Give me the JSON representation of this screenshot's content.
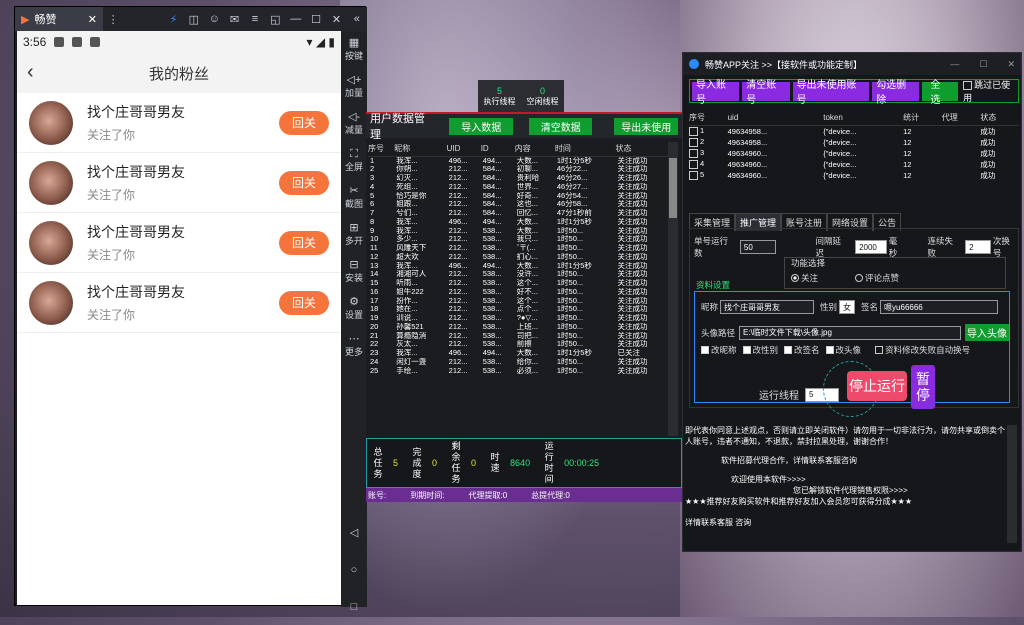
{
  "emulator": {
    "tab_title": "畅赞",
    "side": [
      "按键",
      "加量",
      "减量",
      "全屏",
      "截图",
      "多开",
      "安装",
      "设置",
      "更多"
    ]
  },
  "phone": {
    "time": "3:56",
    "page_title": "我的粉丝",
    "fans": [
      {
        "name": "找个庄哥哥男友",
        "sub": "关注了你",
        "btn": "回关"
      },
      {
        "name": "找个庄哥哥男友",
        "sub": "关注了你",
        "btn": "回关"
      },
      {
        "name": "找个庄哥哥男友",
        "sub": "关注了你",
        "btn": "回关"
      },
      {
        "name": "找个庄哥哥男友",
        "sub": "关注了你",
        "btn": "回关"
      }
    ]
  },
  "threads": {
    "exec_value": "5",
    "exec_label": "执行线程",
    "idle_value": "0",
    "idle_label": "空闲线程"
  },
  "userdata": {
    "title": "用户数据管理",
    "import": "导入数据",
    "clear": "清空数据",
    "export": "导出未使用",
    "columns": [
      "序号",
      "昵称",
      "UID",
      "ID",
      "内容",
      "时间",
      "状态"
    ],
    "rows": [
      [
        "1",
        "我浑...",
        "496...",
        "494...",
        "大数...",
        "1时1分5秒",
        "关注成功"
      ],
      [
        "2",
        "你朔...",
        "212...",
        "584...",
        "初聊...",
        "46分22...",
        "关注成功"
      ],
      [
        "3",
        "幻灭...",
        "212...",
        "584...",
        "贵利哈",
        "46分26...",
        "关注成功"
      ],
      [
        "4",
        "死组...",
        "212...",
        "584...",
        "世界...",
        "46分27...",
        "关注成功"
      ],
      [
        "5",
        "恰巧是你",
        "212...",
        "584...",
        "好奇...",
        "46分54...",
        "关注成功"
      ],
      [
        "6",
        "姐跟...",
        "212...",
        "584...",
        "这也...",
        "46分58...",
        "关注成功"
      ],
      [
        "7",
        "兮们...",
        "212...",
        "584...",
        "回忆...",
        "47分1秒前",
        "关注成功"
      ],
      [
        "8",
        "我浑...",
        "496...",
        "494...",
        "大数...",
        "1时1分5秒",
        "关注成功"
      ],
      [
        "9",
        "我浑...",
        "212...",
        "538...",
        "大数...",
        "1时50...",
        "关注成功"
      ],
      [
        "10",
        "多少...",
        "212...",
        "538...",
        "我只...",
        "1时50...",
        "关注成功"
      ],
      [
        "11",
        "风雕天下",
        "212...",
        "538...",
        "ˇ〒(...",
        "1时50...",
        "关注成功"
      ],
      [
        "12",
        "超大欢",
        "212...",
        "538...",
        "扪心...",
        "1时50...",
        "关注成功"
      ],
      [
        "13",
        "我浑...",
        "496...",
        "494...",
        "大数...",
        "1时1分5秒",
        "关注成功"
      ],
      [
        "14",
        "湘湘可人",
        "212...",
        "538...",
        "没许...",
        "1时50...",
        "关注成功"
      ],
      [
        "15",
        "听雨...",
        "212...",
        "538...",
        "这个...",
        "1时50...",
        "关注成功"
      ],
      [
        "16",
        "姐牛222",
        "212...",
        "538...",
        "好不...",
        "1时50...",
        "关注成功"
      ],
      [
        "17",
        "扮作...",
        "212...",
        "538...",
        "这个...",
        "1时50...",
        "关注成功"
      ],
      [
        "18",
        "她在...",
        "212...",
        "538...",
        "点个...",
        "1时50...",
        "关注成功"
      ],
      [
        "19",
        "训说...",
        "212...",
        "538...",
        "?●▽...",
        "1时50...",
        "关注成功"
      ],
      [
        "20",
        "孙馨521",
        "212...",
        "538...",
        "上班...",
        "1时50...",
        "关注成功"
      ],
      [
        "21",
        "算瘾隐消",
        "212...",
        "538...",
        "司把...",
        "1时50...",
        "关注成功"
      ],
      [
        "22",
        "灰太...",
        "212...",
        "538...",
        "前擦",
        "1时50...",
        "关注成功"
      ],
      [
        "23",
        "我浑...",
        "496...",
        "494...",
        "大数...",
        "1时1分5秒",
        "已关注"
      ],
      [
        "24",
        "闲灯一盏",
        "212...",
        "538...",
        "给你...",
        "1时50...",
        "关注成功"
      ],
      [
        "25",
        "手绘...",
        "212...",
        "538...",
        "必须...",
        "1时50...",
        "关注成功"
      ]
    ]
  },
  "stats": {
    "total_label": "总任务",
    "total": "5",
    "done_label": "完成度",
    "done": "0",
    "remain_label": "剩余任务",
    "remain": "0",
    "time_label": "时速",
    "speed": "8640",
    "run_label": "运行时间",
    "runtime": "00:00:25"
  },
  "footer": {
    "account": "账号:",
    "expire": "到期时间:",
    "agent": "代理提取:0",
    "total_agent": "总提代理:0"
  },
  "win": {
    "title": "畅赞APP关注 >>【接软件或功能定制】",
    "buttons": [
      "导入账号",
      "清空账号",
      "导出未使用账号",
      "勾选删除",
      "全选"
    ],
    "skip": "跳过已使用",
    "acct_cols": [
      "序号",
      "uid",
      "token",
      "统计",
      "代理",
      "状态"
    ],
    "accts": [
      [
        "1",
        "49634958...",
        "{\"device...",
        "12",
        "",
        "成功"
      ],
      [
        "2",
        "49634958...",
        "{\"device...",
        "12",
        "",
        "成功"
      ],
      [
        "3",
        "49634960...",
        "{\"device...",
        "12",
        "",
        "成功"
      ],
      [
        "4",
        "49634960...",
        "{\"device...",
        "12",
        "",
        "成功"
      ],
      [
        "5",
        "49634960...",
        "{\"device...",
        "12",
        "",
        "成功"
      ]
    ],
    "tabs": [
      "采集管理",
      "推广管理",
      "账号注册",
      "网络设置",
      "公告"
    ],
    "single_label": "单号运行数",
    "single": "50",
    "interval_label": "间隔延迟",
    "interval": "2000",
    "ms": "毫秒",
    "fail_label": "连续失败",
    "fail": "2",
    "switch": "次换号",
    "fn_title": "功能选择",
    "fn_follow": "关注",
    "fn_like": "评论点赞",
    "profile_tab": "资料设置",
    "nick_label": "昵称",
    "nick": "找个庄哥哥男友",
    "gender_label": "性别",
    "gender": "女",
    "sign_label": "签名",
    "sign": "嗯yu66666",
    "avatar_label": "头像路径",
    "avatar_path": "E:\\临时文件下载\\头像.jpg",
    "import_avatar": "导入头像",
    "checks": [
      "改昵称",
      "改性别",
      "改签名",
      "改头像",
      "资料修改失败自动换号"
    ],
    "thread_label": "运行线程",
    "thread": "5",
    "stop": "停止运行",
    "pause": "暂停",
    "log": [
      "即代表你同意上述观点，否则请立即关闭软件）请勿用于一切非法行为，请勿共享或倒卖个人账号，违者不通知，不退款，禁封拉黑处理，谢谢合作！",
      "软件招募代理合作，详情联系客服咨询",
      "欢迎使用本软件>>>>",
      "您已解锁软件代理销售权限>>>>",
      "★★★推荐好友购买软件和推荐好友加入会员您可获得分成★★★",
      "详情联系客服  咨询"
    ]
  }
}
